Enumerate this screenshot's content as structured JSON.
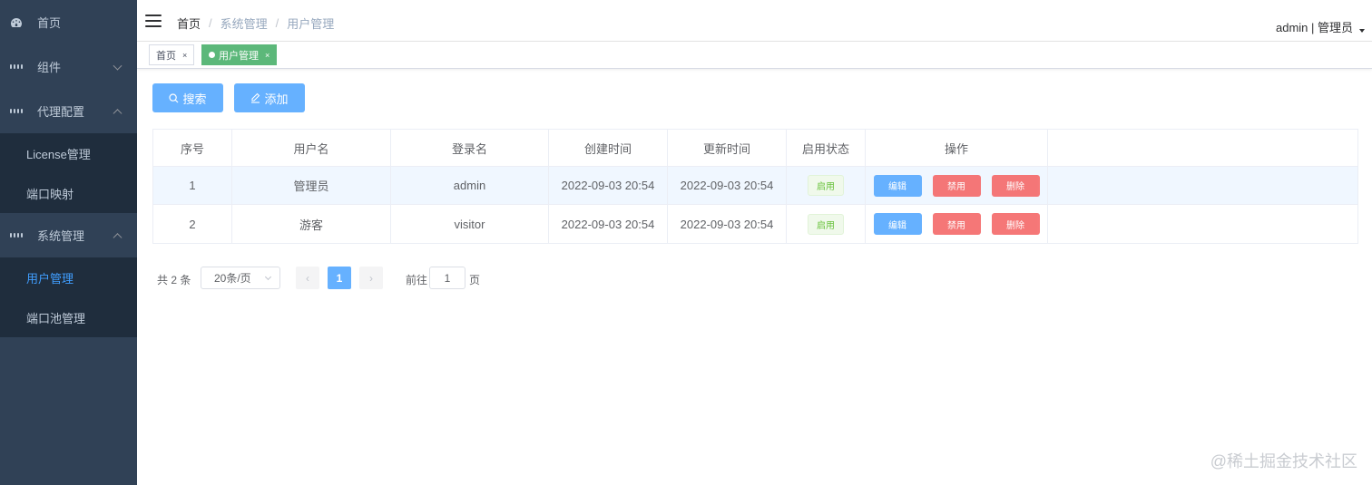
{
  "sidebar": {
    "items": [
      {
        "label": "首页",
        "icon": "dashboard-icon"
      },
      {
        "label": "组件",
        "icon": "grid-icon"
      },
      {
        "label": "代理配置",
        "icon": "grid-icon"
      },
      {
        "label": "系统管理",
        "icon": "grid-icon"
      }
    ],
    "proxy_sub": [
      {
        "label": "License管理"
      },
      {
        "label": "端口映射"
      }
    ],
    "system_sub": [
      {
        "label": "用户管理",
        "active": true
      },
      {
        "label": "端口池管理"
      }
    ]
  },
  "navbar": {
    "breadcrumb": [
      "首页",
      "系统管理",
      "用户管理"
    ],
    "user": "admin | 管理员"
  },
  "tags": [
    {
      "label": "首页",
      "close": "×"
    },
    {
      "label": "用户管理",
      "close": "×",
      "active": true
    }
  ],
  "toolbar": {
    "search_label": "搜索",
    "add_label": "添加"
  },
  "table": {
    "headers": [
      "序号",
      "用户名",
      "登录名",
      "创建时间",
      "更新时间",
      "启用状态",
      "操作"
    ],
    "rows": [
      {
        "index": "1",
        "username": "管理员",
        "login": "admin",
        "created": "2022-09-03 20:54",
        "updated": "2022-09-03 20:54",
        "status": "启用"
      },
      {
        "index": "2",
        "username": "游客",
        "login": "visitor",
        "created": "2022-09-03 20:54",
        "updated": "2022-09-03 20:54",
        "status": "启用"
      }
    ],
    "actions": {
      "edit": "编辑",
      "disable": "禁用",
      "delete": "删除"
    }
  },
  "pagination": {
    "total": "共 2 条",
    "page_size": "20条/页",
    "current_page": "1",
    "prev": "‹",
    "next": "›",
    "goto_label": "前往",
    "goto_value": "1",
    "goto_suffix": "页"
  },
  "watermark": "@稀土掘金技术社区",
  "colors": {
    "sidebar_bg": "#304156",
    "submenu_bg": "#1f2d3d",
    "primary": "#66b1ff",
    "active_tag": "#5cb87a",
    "danger": "#f56c6c",
    "success": "#67c23a"
  }
}
